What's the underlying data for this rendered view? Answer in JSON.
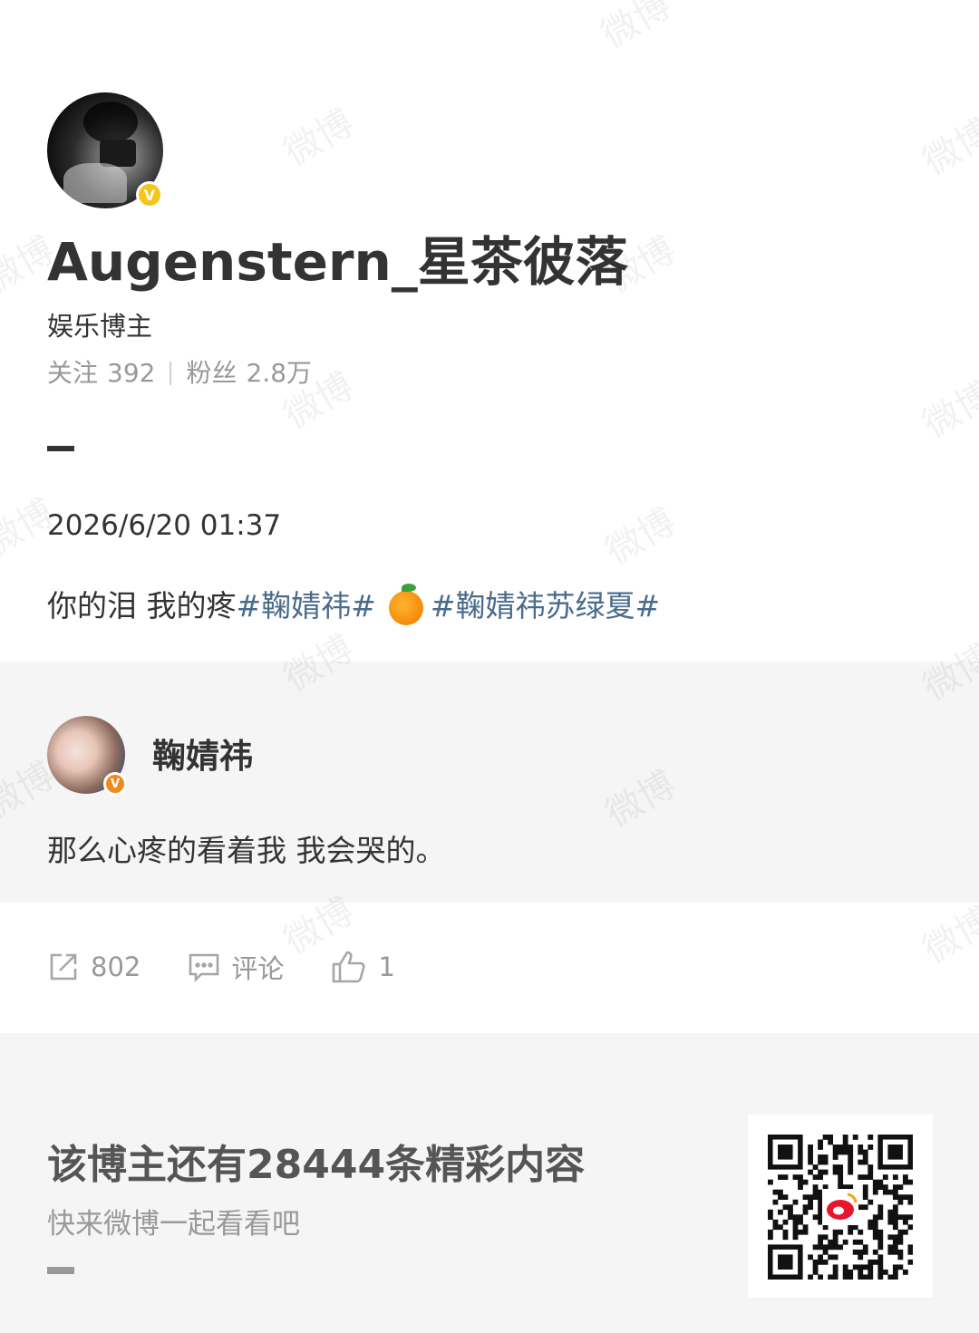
{
  "profile": {
    "username": "Augenstern_星茶彼落",
    "category": "娱乐博主",
    "following_label": "关注",
    "following_count": "392",
    "followers_label": "粉丝",
    "followers_count": "2.8万",
    "verified_badge": "V"
  },
  "post": {
    "date": "2026/6/20 01:37",
    "text": "你的泪 我的疼",
    "hashtag1": "#鞠婧祎#",
    "emoji": "orange-icon",
    "hashtag2": "#鞠婧祎苏绿夏#"
  },
  "repost": {
    "author": "鞠婧祎",
    "verified_badge": "V",
    "text": "那么心疼的看着我 我会哭的。"
  },
  "actions": {
    "share_count": "802",
    "comment_label": "评论",
    "like_count": "1"
  },
  "footer": {
    "title": "该博主还有28444条精彩内容",
    "subtitle": "快来微博一起看看吧"
  },
  "watermark": "微博",
  "colors": {
    "hashtag": "#4a6c8c",
    "muted": "#999999",
    "text": "#333333",
    "panel": "#f5f5f5",
    "badge_gold": "#f5c518",
    "badge_orange": "#f08a1c"
  }
}
